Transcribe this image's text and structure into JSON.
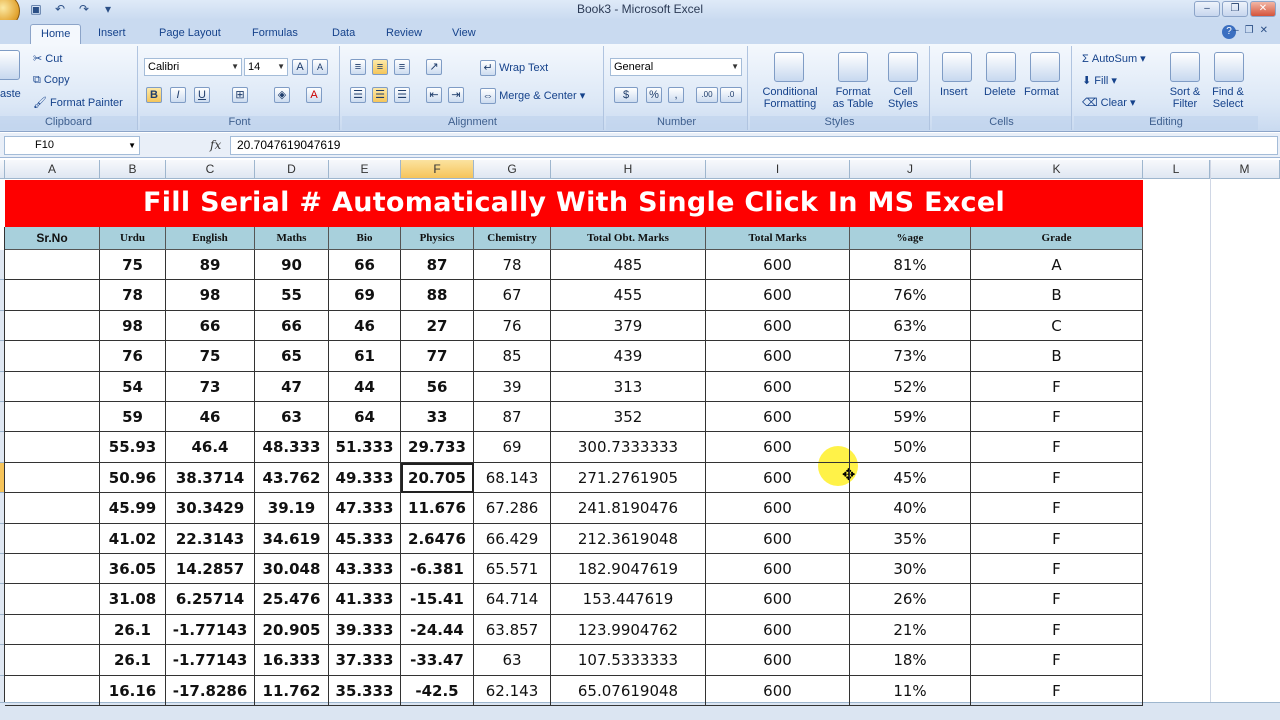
{
  "window": {
    "title": "Book3 - Microsoft Excel"
  },
  "tabs": [
    "Home",
    "Insert",
    "Page Layout",
    "Formulas",
    "Data",
    "Review",
    "View"
  ],
  "active_tab": "Home",
  "ribbon": {
    "clipboard": {
      "paste": "aste",
      "cut": "Cut",
      "copy": "Copy",
      "format_painter": "Format Painter",
      "label": "Clipboard"
    },
    "font": {
      "name": "Calibri",
      "size": "14",
      "label": "Font",
      "bold": "B",
      "italic": "I",
      "underline": "U",
      "grow": "A",
      "shrink": "A",
      "font_color": "A"
    },
    "alignment": {
      "wrap": "Wrap Text",
      "merge": "Merge & Center",
      "label": "Alignment"
    },
    "number": {
      "format": "General",
      "currency": "$",
      "percent": "%",
      "comma": ",",
      "inc": ".00",
      "dec": ".0",
      "label": "Number"
    },
    "styles": {
      "conditional_1": "Conditional",
      "conditional_2": "Formatting",
      "table_1": "Format",
      "table_2": "as Table",
      "cell_1": "Cell",
      "cell_2": "Styles",
      "label": "Styles"
    },
    "cells": {
      "insert": "Insert",
      "delete": "Delete",
      "format": "Format",
      "label": "Cells"
    },
    "editing": {
      "autosum": "AutoSum",
      "fill": "Fill",
      "clear": "Clear",
      "sort_1": "Sort &",
      "sort_2": "Filter",
      "find_1": "Find &",
      "find_2": "Select",
      "label": "Editing"
    }
  },
  "formula_bar": {
    "name_box": "F10",
    "fx": "fx",
    "content": "20.7047619047619"
  },
  "columns": [
    "A",
    "B",
    "C",
    "D",
    "E",
    "F",
    "G",
    "H",
    "I",
    "J",
    "K",
    "L",
    "M"
  ],
  "selected_column": "F",
  "banner": "Fill Serial # Automatically With Single Click In MS Excel",
  "headers": [
    "Sr.No",
    "Urdu",
    "English",
    "Maths",
    "Bio",
    "Physics",
    "Chemistry",
    "Total Obt. Marks",
    "Total Marks",
    "%age",
    "Grade"
  ],
  "rows": [
    [
      "",
      "75",
      "89",
      "90",
      "66",
      "87",
      "78",
      "485",
      "600",
      "81%",
      "A"
    ],
    [
      "",
      "78",
      "98",
      "55",
      "69",
      "88",
      "67",
      "455",
      "600",
      "76%",
      "B"
    ],
    [
      "",
      "98",
      "66",
      "66",
      "46",
      "27",
      "76",
      "379",
      "600",
      "63%",
      "C"
    ],
    [
      "",
      "76",
      "75",
      "65",
      "61",
      "77",
      "85",
      "439",
      "600",
      "73%",
      "B"
    ],
    [
      "",
      "54",
      "73",
      "47",
      "44",
      "56",
      "39",
      "313",
      "600",
      "52%",
      "F"
    ],
    [
      "",
      "59",
      "46",
      "63",
      "64",
      "33",
      "87",
      "352",
      "600",
      "59%",
      "F"
    ],
    [
      "",
      "55.93",
      "46.4",
      "48.333",
      "51.333",
      "29.733",
      "69",
      "300.7333333",
      "600",
      "50%",
      "F"
    ],
    [
      "",
      "50.96",
      "38.3714",
      "43.762",
      "49.333",
      "20.705",
      "68.143",
      "271.2761905",
      "600",
      "45%",
      "F"
    ],
    [
      "",
      "45.99",
      "30.3429",
      "39.19",
      "47.333",
      "11.676",
      "67.286",
      "241.8190476",
      "600",
      "40%",
      "F"
    ],
    [
      "",
      "41.02",
      "22.3143",
      "34.619",
      "45.333",
      "2.6476",
      "66.429",
      "212.3619048",
      "600",
      "35%",
      "F"
    ],
    [
      "",
      "36.05",
      "14.2857",
      "30.048",
      "43.333",
      "-6.381",
      "65.571",
      "182.9047619",
      "600",
      "30%",
      "F"
    ],
    [
      "",
      "31.08",
      "6.25714",
      "25.476",
      "41.333",
      "-15.41",
      "64.714",
      "153.447619",
      "600",
      "26%",
      "F"
    ],
    [
      "",
      "26.1",
      "-1.77143",
      "20.905",
      "39.333",
      "-24.44",
      "63.857",
      "123.9904762",
      "600",
      "21%",
      "F"
    ],
    [
      "",
      "26.1",
      "-1.77143",
      "16.333",
      "37.333",
      "-33.47",
      "63",
      "107.5333333",
      "600",
      "18%",
      "F"
    ],
    [
      "",
      "16.16",
      "-17.8286",
      "11.762",
      "35.333",
      "-42.5",
      "62.143",
      "65.07619048",
      "600",
      "11%",
      "F"
    ]
  ],
  "active_cell": {
    "row": 7,
    "col": 5
  },
  "colors": {
    "banner_bg": "#fe0000",
    "header_bg": "#a8d0dc",
    "ribbon": "#dbe7f6"
  }
}
